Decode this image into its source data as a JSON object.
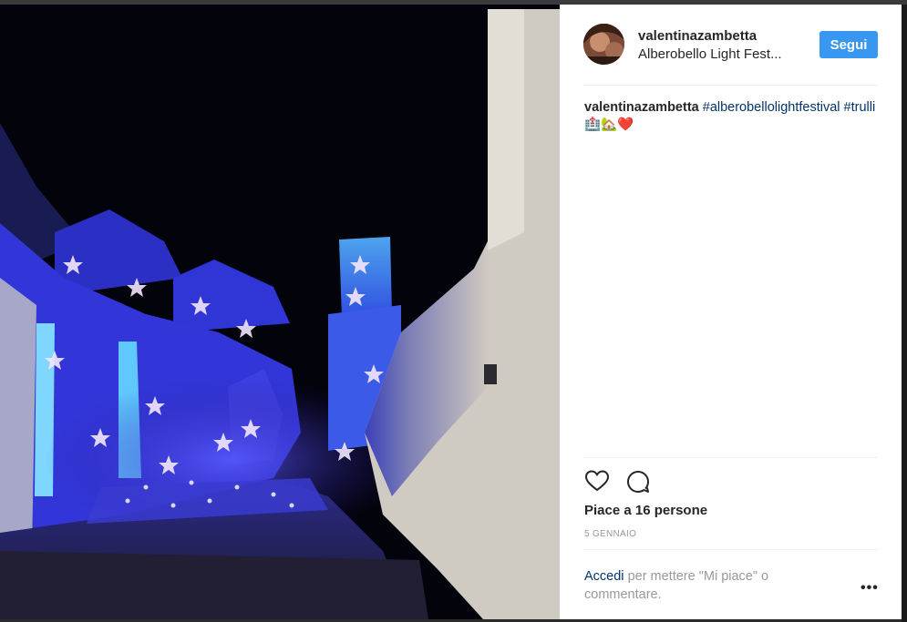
{
  "post": {
    "username": "valentinazambetta",
    "location": "Alberobello Light Fest...",
    "follow_label": "Segui",
    "caption_user": "valentinazambetta",
    "caption_hashtag1": "#alberobellolightfestival",
    "caption_hashtag2": "#trulli",
    "caption_emoji": "🏥🏡❤️",
    "likes": "Piace a 16 persone",
    "date": "5 GENNAIO",
    "login_link": "Accedi",
    "login_text": "per mettere \"Mi piace\" o commentare.",
    "more": "•••"
  },
  "icons": {
    "like": "heart-icon",
    "comment": "comment-icon",
    "more": "more-options-icon"
  },
  "colors": {
    "follow_button": "#3897f0",
    "link": "#003569",
    "muted": "#999999",
    "text": "#262626"
  }
}
